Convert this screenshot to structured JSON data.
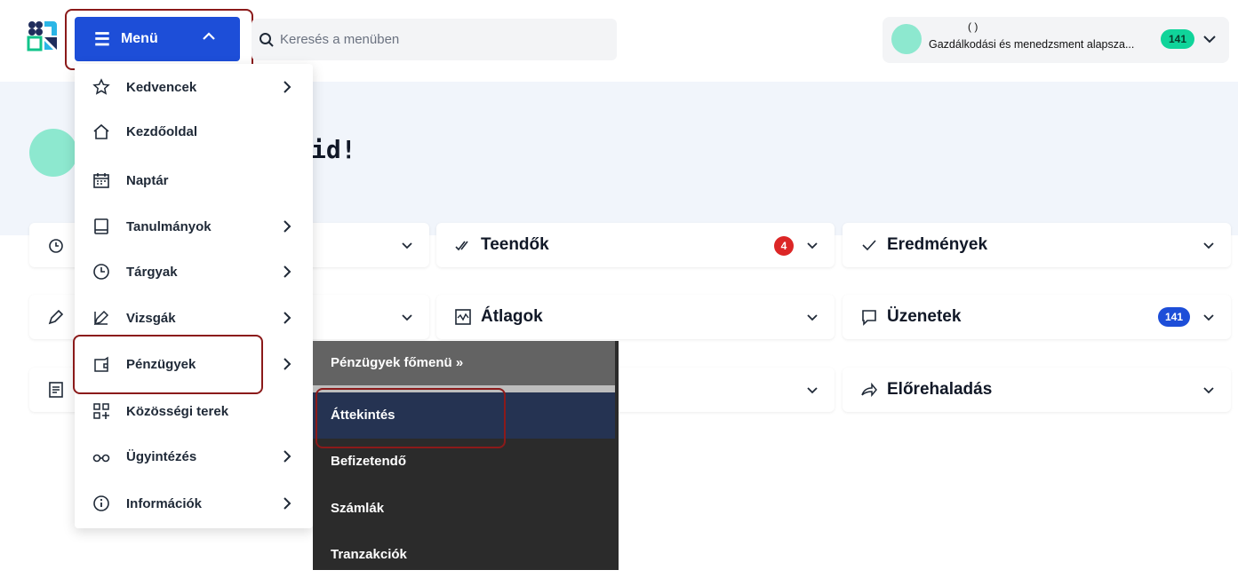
{
  "header": {
    "menu_label": "Menü",
    "search_placeholder": "Keresés a menüben",
    "user": {
      "name_parens": "(          )",
      "program": "Gazdálkodási és menedzsment alapsza...",
      "message_count": "141"
    }
  },
  "hero": {
    "greeting_partial": "id!"
  },
  "menu": {
    "items": [
      {
        "label": "Kedvencek",
        "icon": "star-icon",
        "has_submenu": true
      },
      {
        "label": "Kezdőoldal",
        "icon": "home-icon",
        "has_submenu": false
      },
      {
        "label": "Naptár",
        "icon": "calendar-icon",
        "has_submenu": false
      },
      {
        "label": "Tanulmányok",
        "icon": "book-icon",
        "has_submenu": true
      },
      {
        "label": "Tárgyak",
        "icon": "clock-icon",
        "has_submenu": true
      },
      {
        "label": "Vizsgák",
        "icon": "edit-icon",
        "has_submenu": true
      },
      {
        "label": "Pénzügyek",
        "icon": "wallet-icon",
        "has_submenu": true
      },
      {
        "label": "Közösségi terek",
        "icon": "grid-plus-icon",
        "has_submenu": false
      },
      {
        "label": "Ügyintézés",
        "icon": "glasses-icon",
        "has_submenu": true
      },
      {
        "label": "Információk",
        "icon": "info-icon",
        "has_submenu": true
      }
    ]
  },
  "submenu": {
    "header": "Pénzügyek főmenü »",
    "items": [
      "Áttekintés",
      "Befizetendő",
      "Számlák",
      "Tranzakciók"
    ],
    "active": "Áttekintés"
  },
  "cards": {
    "teendok": {
      "title": "Teendők",
      "badge": "4"
    },
    "eredmenyek": {
      "title": "Eredmények"
    },
    "atlagok": {
      "title": "Átlagok"
    },
    "uzenetek": {
      "title": "Üzenetek",
      "badge": "141"
    },
    "eloerehaladas": {
      "title": "Előrehaladás"
    }
  },
  "colors": {
    "accent": "#1d4ed8",
    "highlight_outline": "#8b1a1a",
    "badge_green": "#10d49a",
    "badge_red": "#dc2626",
    "submenu_bg": "#2b2b2b",
    "submenu_active": "#253352"
  }
}
